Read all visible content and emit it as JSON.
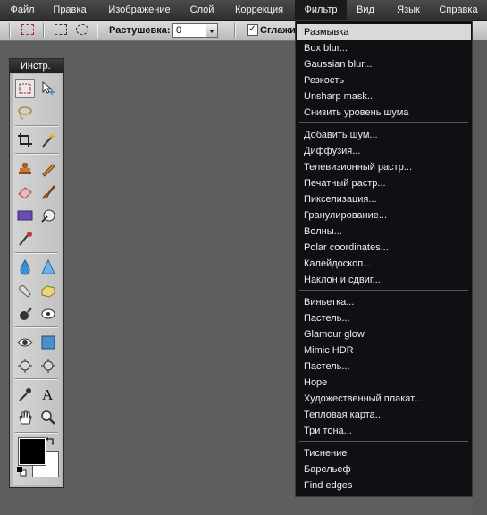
{
  "menubar": {
    "items": [
      "Файл",
      "Правка",
      "Изображение",
      "Слой",
      "Коррекция",
      "Фильтр",
      "Вид",
      "Язык",
      "Справка"
    ],
    "active": "Фильтр"
  },
  "options": {
    "feather_label": "Растушевка:",
    "feather_value": "0",
    "antialias_label": "Сглажи",
    "antialias_checked": true
  },
  "toolbox": {
    "title": "Инстр.",
    "tools": [
      "marquee-icon",
      "move-icon",
      "lasso-icon",
      "crop-icon",
      "magic-wand-icon",
      "stamp-icon",
      "pencil-icon",
      "eraser-icon",
      "brush-icon",
      "rectangle-icon",
      "replace-color-icon",
      "red-eye-icon",
      "blur-icon",
      "sharpen-icon",
      "smudge-icon",
      "sponge-icon",
      "burn-icon",
      "dodge-icon",
      "eye-icon",
      "square-icon",
      "color-picker-left-icon",
      "color-picker-right-icon",
      "eyedropper-icon",
      "text-icon",
      "hand-icon",
      "zoom-icon"
    ],
    "foreground_color": "#000000",
    "background_color": "#ffffff"
  },
  "filter_menu": {
    "groups": [
      [
        "Размывка",
        "Box blur...",
        "Gaussian blur...",
        "Резкость",
        "Unsharp mask...",
        "Снизить уровень шума"
      ],
      [
        "Добавить шум...",
        "Диффузия...",
        "Телевизионный растр...",
        "Печатный растр...",
        "Пикселизация...",
        "Гранулирование...",
        "Волны...",
        "Polar coordinates...",
        "Калейдоскоп...",
        "Наклон и сдвиг..."
      ],
      [
        "Виньетка...",
        "Пастель...",
        "Glamour glow",
        "Mimic HDR",
        "Пастель...",
        "Hope",
        "Художественный плакат...",
        "Тепловая карта...",
        "Три тона..."
      ],
      [
        "Тиснение",
        "Барельеф",
        "Find edges"
      ]
    ],
    "highlighted": "Размывка"
  }
}
